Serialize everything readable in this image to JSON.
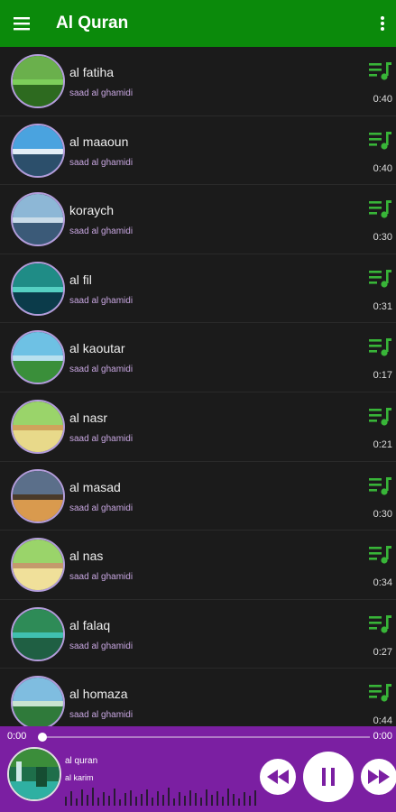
{
  "app": {
    "title": "Al Quran"
  },
  "colors": {
    "appbar": "#0b8a0b",
    "accent_green": "#38b538",
    "player": "#7b1fa2",
    "artist_text": "#c7a6e0"
  },
  "icons": {
    "menu": "hamburger-menu-icon",
    "more": "more-vert-icon",
    "queue": "playlist-music-icon"
  },
  "tracks": [
    {
      "name": "al fatiha",
      "artist": "saad al ghamidi",
      "duration": "0:40"
    },
    {
      "name": "al maaoun",
      "artist": "saad al ghamidi",
      "duration": "0:40"
    },
    {
      "name": "koraych",
      "artist": "saad al ghamidi",
      "duration": "0:30"
    },
    {
      "name": "al fil",
      "artist": "saad al ghamidi",
      "duration": "0:31"
    },
    {
      "name": "al kaoutar",
      "artist": "saad al ghamidi",
      "duration": "0:17"
    },
    {
      "name": "al nasr",
      "artist": "saad al ghamidi",
      "duration": "0:21"
    },
    {
      "name": "al masad",
      "artist": "saad al ghamidi",
      "duration": "0:30"
    },
    {
      "name": "al nas",
      "artist": "saad al ghamidi",
      "duration": "0:34"
    },
    {
      "name": "al falaq",
      "artist": "saad al ghamidi",
      "duration": "0:27"
    },
    {
      "name": "al homaza",
      "artist": "saad al ghamidi",
      "duration": "0:44"
    }
  ],
  "player": {
    "elapsed": "0:00",
    "total": "0:00",
    "progress": 0,
    "title": "al quran",
    "artist": "al karim"
  }
}
